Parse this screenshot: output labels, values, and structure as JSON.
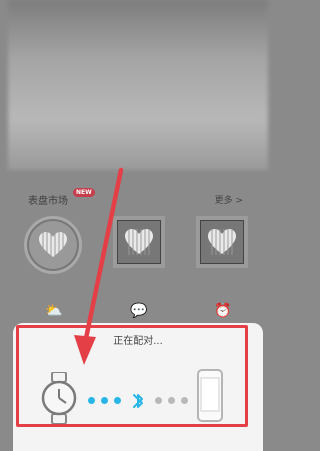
{
  "market": {
    "title": "表盘市场",
    "badge": "NEW",
    "more": "更多 >"
  },
  "pairing": {
    "status": "正在配对..."
  },
  "icons": {
    "weather": "weather-icon",
    "message": "message-icon",
    "alarm": "alarm-clock-icon",
    "watch": "watch-icon",
    "bluetooth": "bluetooth-icon",
    "phone": "phone-icon"
  },
  "colors": {
    "accent_red": "#e43f47",
    "dot_blue": "#28b6e8",
    "dot_gray": "#b8b8b8"
  }
}
